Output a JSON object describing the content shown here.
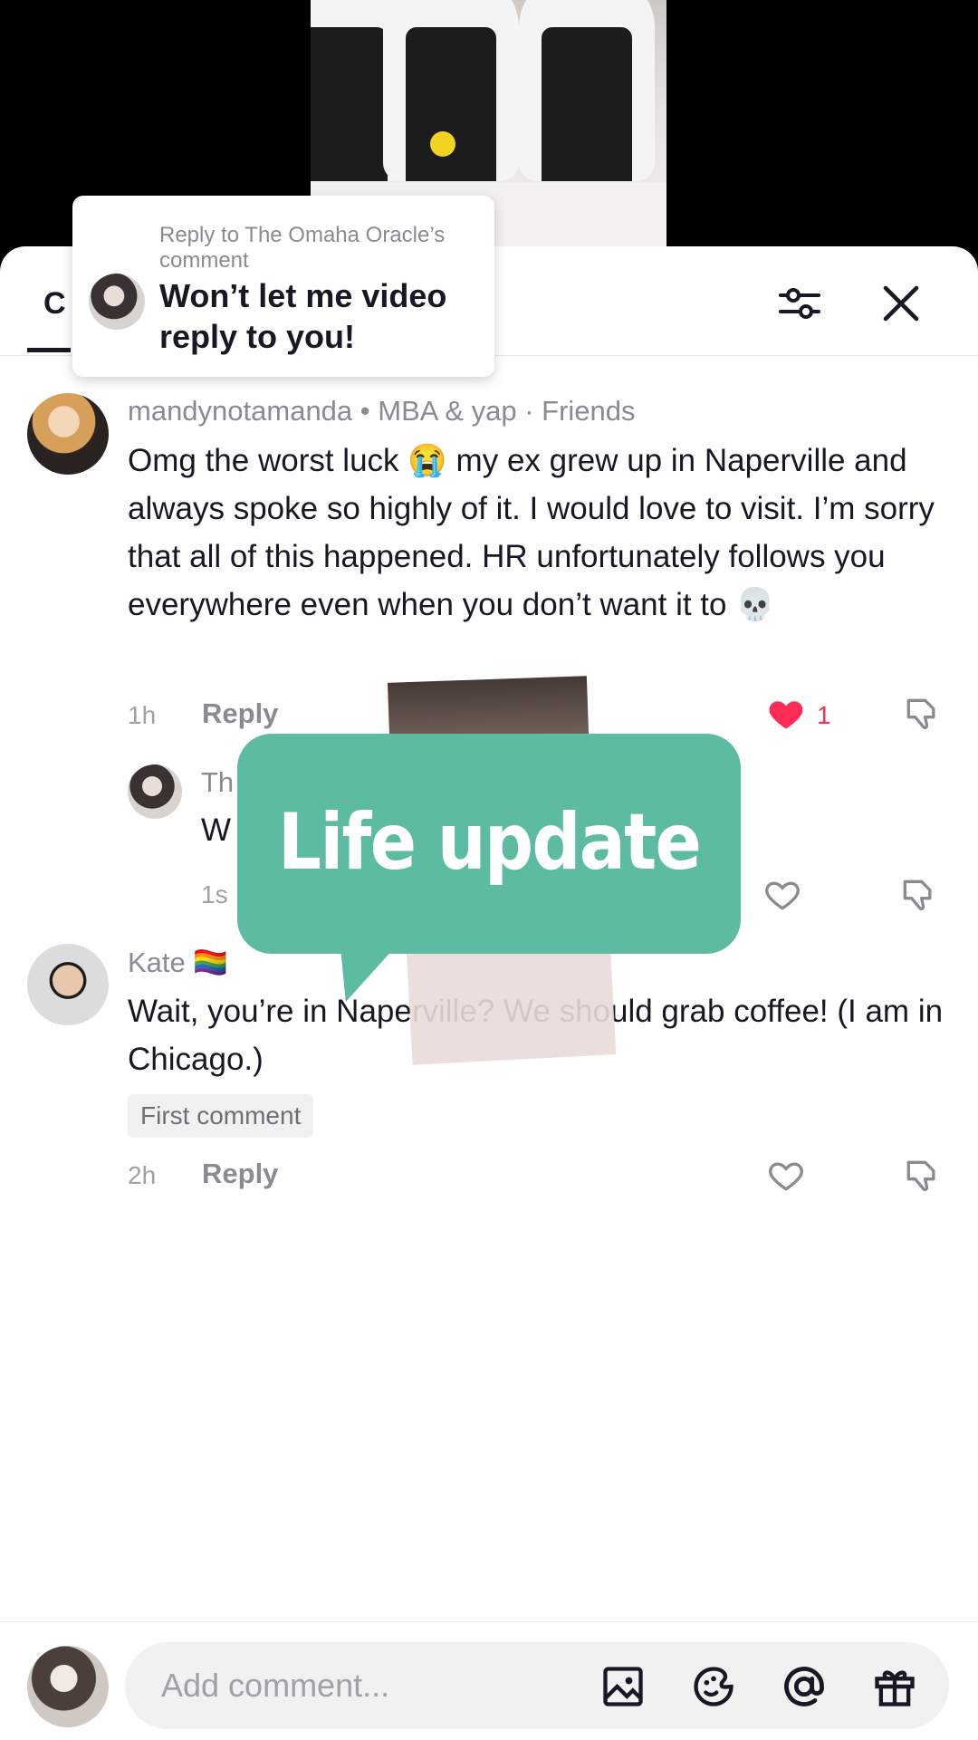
{
  "header": {
    "tab_label": "C",
    "filter_icon": "filter-sliders-icon",
    "close_icon": "close-icon"
  },
  "reply_card": {
    "subtitle": "Reply to The Omaha Oracle’s comment",
    "text": "Won’t let me video reply to you!"
  },
  "comments": [
    {
      "username": "mandynotamanda • MBA & yap · Friends",
      "text": "Omg the worst luck 😭 my ex grew up in Naperville and always spoke so highly of it. I would love to visit. I’m sorry that all of this happened. HR unfortunately follows you everywhere even when you don’t want it to 💀",
      "time": "1h",
      "reply_label": "Reply",
      "likes": "1",
      "liked": true
    },
    {
      "username": "Th",
      "text": "W",
      "time": "1s"
    },
    {
      "username": "Kate 🏳️‍🌈",
      "text": "Wait, you’re in Naperville? We should grab coffee! (I am in Chicago.)",
      "badge": "First comment",
      "time": "2h",
      "reply_label": "Reply"
    }
  ],
  "overlay": {
    "sticker_text": "Life update",
    "sticker_color": "#5cbba1"
  },
  "input_bar": {
    "placeholder": "Add comment...",
    "icons": [
      "image-icon",
      "sticker-icon",
      "mention-icon",
      "gift-icon"
    ]
  },
  "colors": {
    "like_red": "#fe2c55",
    "text": "#161823",
    "muted": "#8a8b91"
  }
}
